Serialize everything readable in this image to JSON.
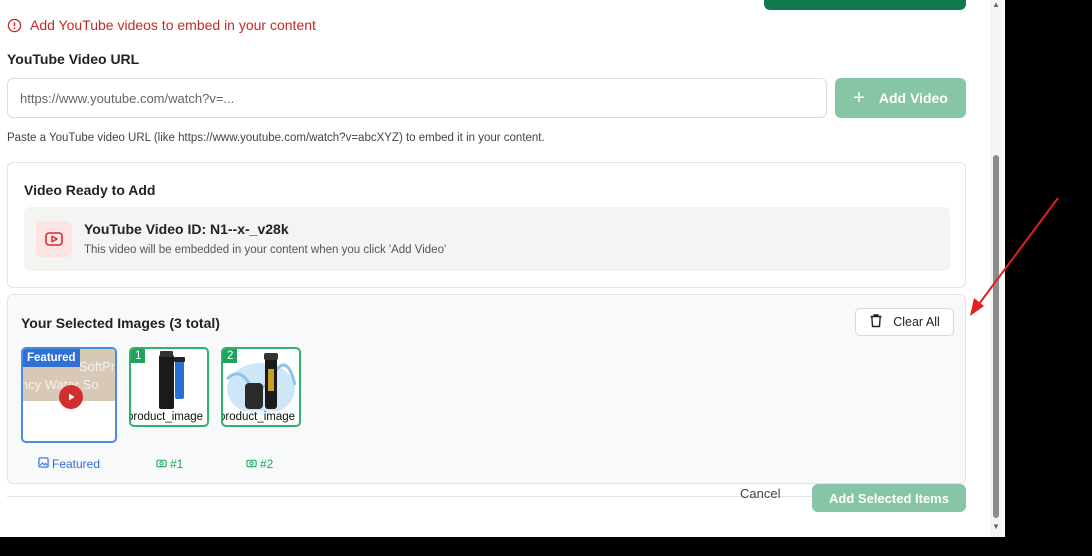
{
  "alert": {
    "text": "Add YouTube videos to embed in your content"
  },
  "url_section": {
    "label": "YouTube Video URL",
    "placeholder": "https://www.youtube.com/watch?v=...",
    "value": "",
    "add_button_label": "Add Video",
    "help_text": "Paste a YouTube video URL (like https://www.youtube.com/watch?v=abcXYZ) to embed it in your content."
  },
  "ready_card": {
    "title": "Video Ready to Add",
    "video_id_text": "YouTube Video ID: N1--x-_v28k",
    "note": "This video will be embedded in your content when you click 'Add Video'"
  },
  "selected": {
    "title": "Your Selected Images (3 total)",
    "clear_label": "Clear All",
    "featured_badge": "Featured",
    "featured_bg_text_1": "SoftPro",
    "featured_bg_text_2": "ncy Water So",
    "items": [
      {
        "badge": "1",
        "caption": "product_image",
        "label": "#1"
      },
      {
        "badge": "2",
        "caption": "product_image",
        "label": "#2"
      }
    ],
    "featured_caption": "Featured"
  },
  "footer": {
    "cancel_label": "Cancel",
    "add_selected_label": "Add Selected Items"
  },
  "colors": {
    "accent_green": "#86c5a5",
    "brand_green": "#0f7a4c",
    "alert_red": "#c62828",
    "featured_blue": "#2e6fd8",
    "annotation_arrow": "#e02020"
  }
}
